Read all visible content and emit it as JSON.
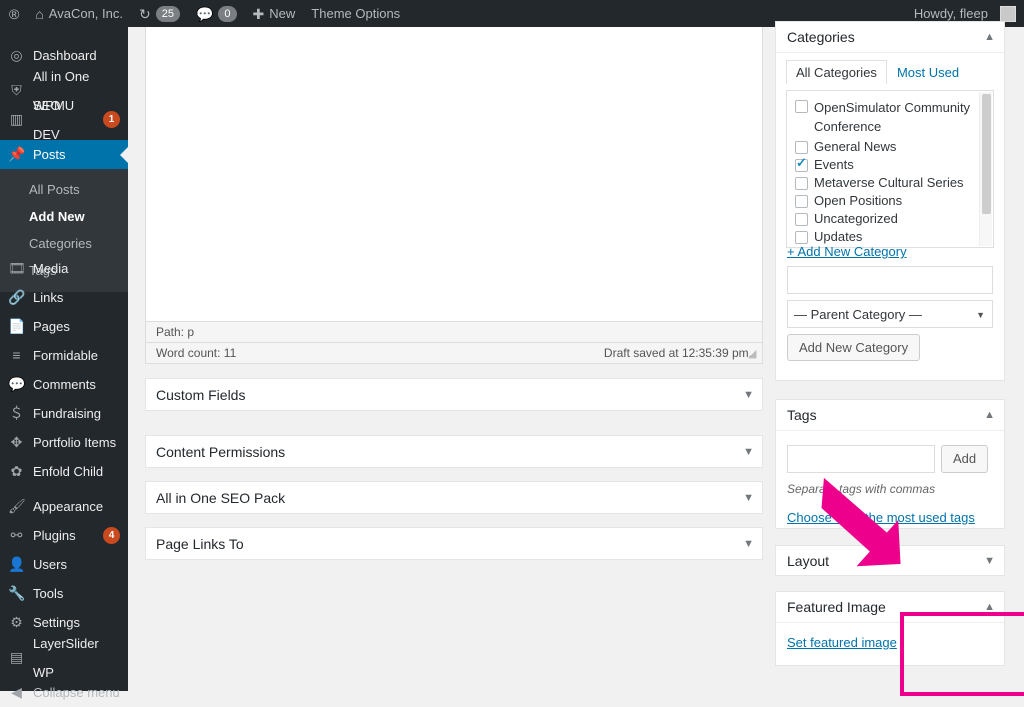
{
  "adminbar": {
    "wp_icon": "wordpress-icon",
    "site_name": "AvaCon, Inc.",
    "home_icon": "home-icon",
    "updates_icon": "updates-icon",
    "updates_count": "25",
    "comments_icon": "comment-icon",
    "comments_count": "0",
    "new_icon": "plus-icon",
    "new_label": "New",
    "theme_options_label": "Theme Options",
    "howdy": "Howdy, fleep"
  },
  "sidebar": {
    "items": [
      {
        "label": "Dashboard",
        "icon": "dashboard-icon",
        "badge": ""
      },
      {
        "label": "All in One SEO",
        "icon": "shield-icon",
        "badge": ""
      },
      {
        "label": "WPMU DEV",
        "icon": "chart-icon",
        "badge": "1"
      },
      {
        "label": "Posts",
        "icon": "pin-icon",
        "badge": ""
      },
      {
        "label": "Media",
        "icon": "media-icon",
        "badge": ""
      },
      {
        "label": "Links",
        "icon": "link-icon",
        "badge": ""
      },
      {
        "label": "Pages",
        "icon": "page-icon",
        "badge": ""
      },
      {
        "label": "Formidable",
        "icon": "formidable-icon",
        "badge": ""
      },
      {
        "label": "Comments",
        "icon": "comment-icon",
        "badge": ""
      },
      {
        "label": "Fundraising",
        "icon": "dollar-icon",
        "badge": ""
      },
      {
        "label": "Portfolio Items",
        "icon": "portfolio-icon",
        "badge": ""
      },
      {
        "label": "Enfold Child",
        "icon": "gear-icon",
        "badge": ""
      },
      {
        "label": "Appearance",
        "icon": "brush-icon",
        "badge": ""
      },
      {
        "label": "Plugins",
        "icon": "plug-icon",
        "badge": "4"
      },
      {
        "label": "Users",
        "icon": "users-icon",
        "badge": ""
      },
      {
        "label": "Tools",
        "icon": "tools-icon",
        "badge": ""
      },
      {
        "label": "Settings",
        "icon": "settings-icon",
        "badge": ""
      },
      {
        "label": "LayerSlider WP",
        "icon": "layerslider-icon",
        "badge": ""
      }
    ],
    "posts_submenu": [
      {
        "label": "All Posts",
        "current": false
      },
      {
        "label": "Add New",
        "current": true
      },
      {
        "label": "Categories",
        "current": false
      },
      {
        "label": "Tags",
        "current": false
      }
    ],
    "collapse_label": "Collapse menu",
    "collapse_icon": "collapse-arrow-icon"
  },
  "editor": {
    "path_label": "Path: p",
    "word_count": "Word count: 11",
    "draft_saved": "Draft saved at 12:35:39 pm.",
    "resize_handle_icon": "resize-grip-icon"
  },
  "metaboxes": [
    {
      "title": "Custom Fields",
      "toggle_icon": "chevron-down-icon"
    },
    {
      "title": "Content Permissions",
      "toggle_icon": "chevron-down-icon"
    },
    {
      "title": "All in One SEO Pack",
      "toggle_icon": "chevron-down-icon"
    },
    {
      "title": "Page Links To",
      "toggle_icon": "chevron-down-icon"
    }
  ],
  "categories_box": {
    "title": "Categories",
    "toggle_icon": "chevron-up-icon",
    "tabs": [
      {
        "label": "All Categories",
        "active": true
      },
      {
        "label": "Most Used",
        "active": false
      }
    ],
    "items": [
      {
        "label": "OpenSimulator Community Conference",
        "checked": false,
        "wrapped": true
      },
      {
        "label": "General News",
        "checked": false,
        "wrapped": false
      },
      {
        "label": "Events",
        "checked": true,
        "wrapped": false
      },
      {
        "label": "Metaverse Cultural Series",
        "checked": false,
        "wrapped": false
      },
      {
        "label": "Open Positions",
        "checked": false,
        "wrapped": false
      },
      {
        "label": "Uncategorized",
        "checked": false,
        "wrapped": false
      },
      {
        "label": "Updates",
        "checked": false,
        "wrapped": false
      }
    ],
    "add_new_link": "+ Add New Category",
    "new_category_value": "",
    "new_category_placeholder": "",
    "parent_select_value": "— Parent Category —",
    "parent_select_caret": "chevron-down-icon",
    "add_button": "Add New Category"
  },
  "tags_box": {
    "title": "Tags",
    "toggle_icon": "chevron-up-icon",
    "input_value": "",
    "input_placeholder": "",
    "add_button": "Add",
    "note": "Separate tags with commas",
    "choose_link": "Choose from the most used tags"
  },
  "layout_box": {
    "title": "Layout",
    "toggle_icon": "chevron-down-icon"
  },
  "featured_image_box": {
    "title": "Featured Image",
    "toggle_icon": "chevron-up-icon",
    "set_link": "Set featured image"
  },
  "annotation": {
    "arrow_color": "#ec008c",
    "highlight_color": "#ec008c"
  }
}
